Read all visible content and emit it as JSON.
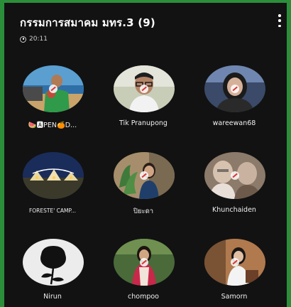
{
  "chat": {
    "title": "กรรมการสมาคม มทร.3 (9)",
    "duration": "20:11"
  },
  "participants": [
    {
      "name": "🍉🅰PEN🍊D...",
      "avatar": "photo-man-green-shirt-beach"
    },
    {
      "name": "Tik Pranupong",
      "avatar": "photo-man-glasses"
    },
    {
      "name": "wareewan68",
      "avatar": "photo-woman-dark-hair"
    },
    {
      "name": "FORESTE' CAMP...",
      "avatar": "photo-forest-camp-logo"
    },
    {
      "name": "ปิยะดา",
      "avatar": "photo-woman-plants"
    },
    {
      "name": "Khunchaiden",
      "avatar": "photo-blurred-people"
    },
    {
      "name": "Nirun",
      "avatar": "rose-silhouette-icon"
    },
    {
      "name": "chompoo",
      "avatar": "photo-woman-red-shirt"
    },
    {
      "name": "Samorn",
      "avatar": "photo-woman-indoor"
    }
  ]
}
